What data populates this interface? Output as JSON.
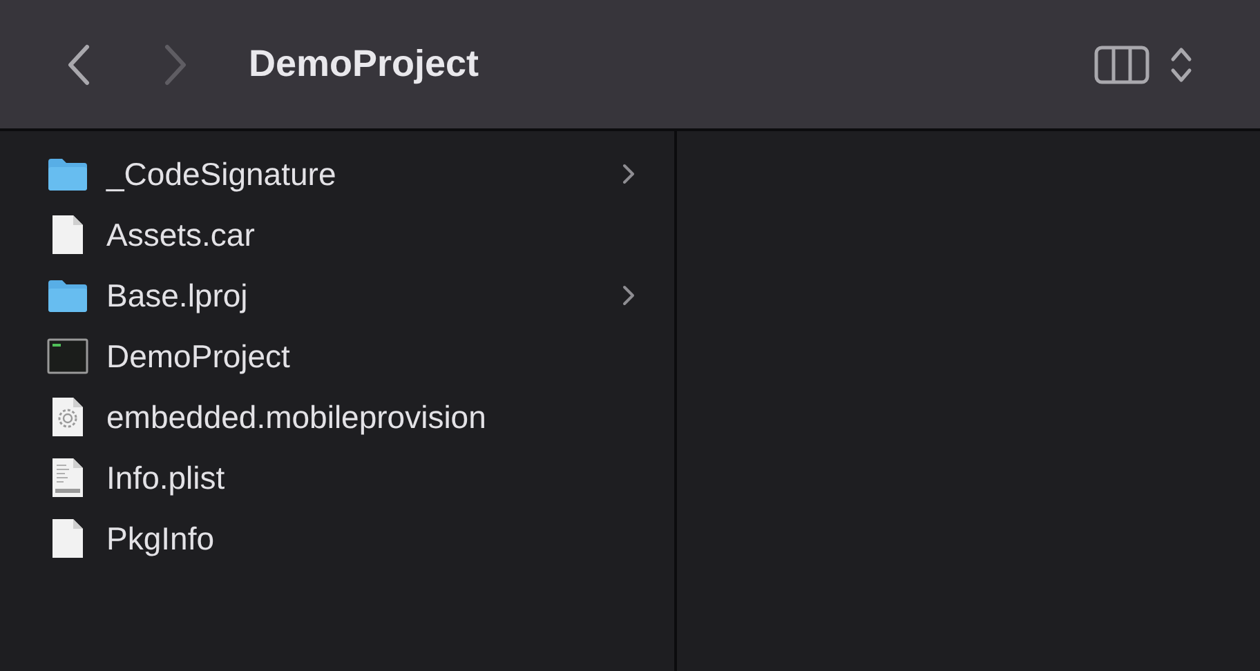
{
  "toolbar": {
    "back": {
      "disabled": false
    },
    "forward": {
      "disabled": true
    },
    "title": "DemoProject"
  },
  "files": [
    {
      "name": "_CodeSignature",
      "kind": "folder",
      "expandable": true
    },
    {
      "name": "Assets.car",
      "kind": "file",
      "expandable": false
    },
    {
      "name": "Base.lproj",
      "kind": "folder",
      "expandable": true
    },
    {
      "name": "DemoProject",
      "kind": "executable",
      "expandable": false
    },
    {
      "name": "embedded.mobileprovision",
      "kind": "provision",
      "expandable": false
    },
    {
      "name": "Info.plist",
      "kind": "plist",
      "expandable": false
    },
    {
      "name": "PkgInfo",
      "kind": "file",
      "expandable": false
    }
  ]
}
